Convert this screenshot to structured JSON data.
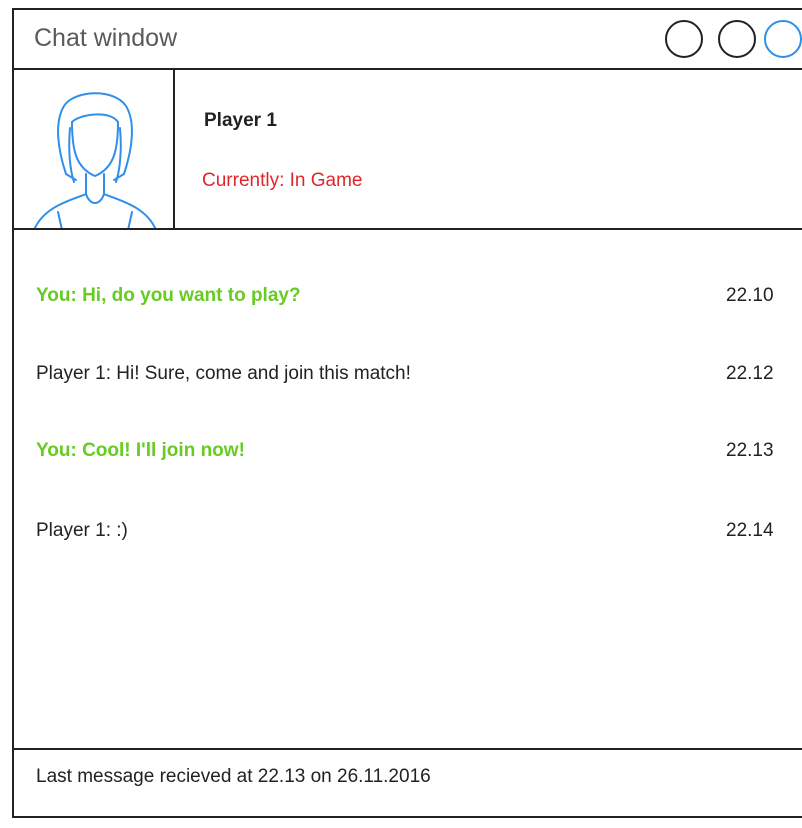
{
  "window": {
    "title": "Chat window",
    "controls": [
      {
        "name": "minimize-button",
        "icon": "circle-icon"
      },
      {
        "name": "maximize-button",
        "icon": "circle-icon"
      },
      {
        "name": "close-button",
        "icon": "circle-icon",
        "accent": "#2f8fea"
      }
    ]
  },
  "profile": {
    "avatar_icon": "user-avatar-icon",
    "name": "Player 1",
    "status": "Currently: In Game",
    "status_color": "#e0262b"
  },
  "messages": [
    {
      "text": "You: Hi, do you want to play?",
      "time": "22.10",
      "from": "self"
    },
    {
      "text": "Player 1: Hi! Sure, come and join this match!",
      "time": "22.12",
      "from": "other"
    },
    {
      "text": "You: Cool! I'll join now!",
      "time": "22.13",
      "from": "self"
    },
    {
      "text": "Player 1: :)",
      "time": "22.14",
      "from": "other"
    }
  ],
  "footer": {
    "status": "Last message recieved at 22.13 on 26.11.2016"
  },
  "colors": {
    "self_message": "#66cc22",
    "other_message": "#222222",
    "accent": "#2f8fea"
  }
}
